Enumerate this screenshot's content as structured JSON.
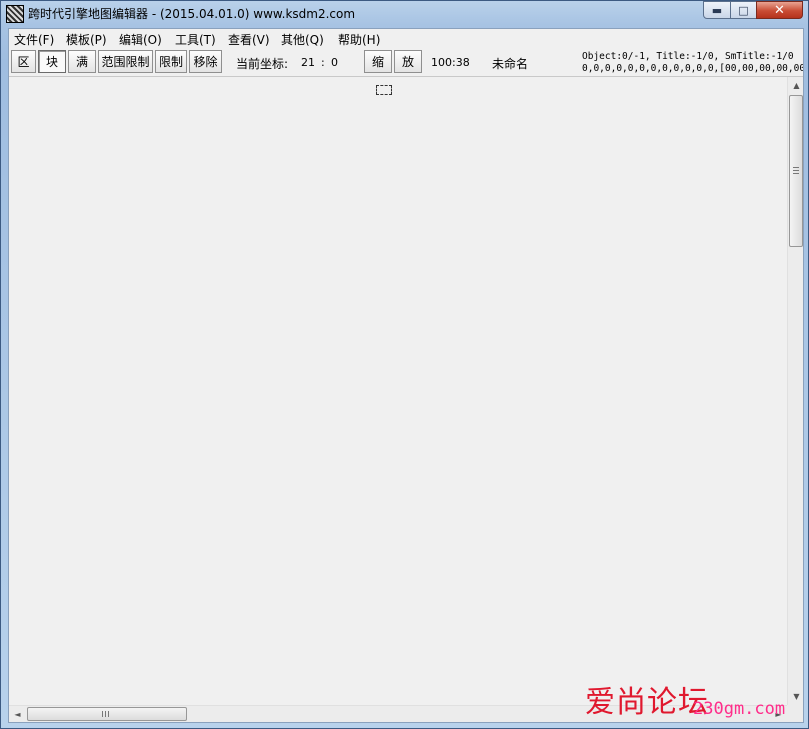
{
  "window": {
    "title": "跨时代引擎地图编辑器 - (2015.04.01.0) www.ksdm2.com",
    "min_glyph": "▬",
    "max_glyph": "□",
    "close_glyph": "✕"
  },
  "menu": {
    "items": [
      "文件(F)",
      "模板(P)",
      "编辑(O)",
      "工具(T)",
      "查看(V)",
      "其他(Q)",
      "帮助(H)"
    ]
  },
  "toolbar": {
    "btn_zone": "区",
    "btn_block": "块",
    "btn_full": "满",
    "btn_range_limit": "范围限制",
    "btn_limit": "限制",
    "btn_remove": "移除",
    "coord_label": "当前坐标:",
    "coord_x": "21",
    "coord_sep": ":",
    "coord_y": "0",
    "btn_zoom_out": "缩",
    "btn_zoom_in": "放",
    "zoom_value": "100:38",
    "file_name": "未命名",
    "info_line1": "Object:0/-1, Title:-1/0, SmTitle:-1/0",
    "info_line2": "0,0,0,0,0,0,0,0,0,0,0,0,[00,00,00,00,00"
  },
  "scroll": {
    "grip": "≡",
    "up": "▲",
    "down": "▼",
    "left": "◄",
    "right": "►"
  },
  "watermark": {
    "main": "爱尚论坛",
    "sub": "230gm.com"
  }
}
